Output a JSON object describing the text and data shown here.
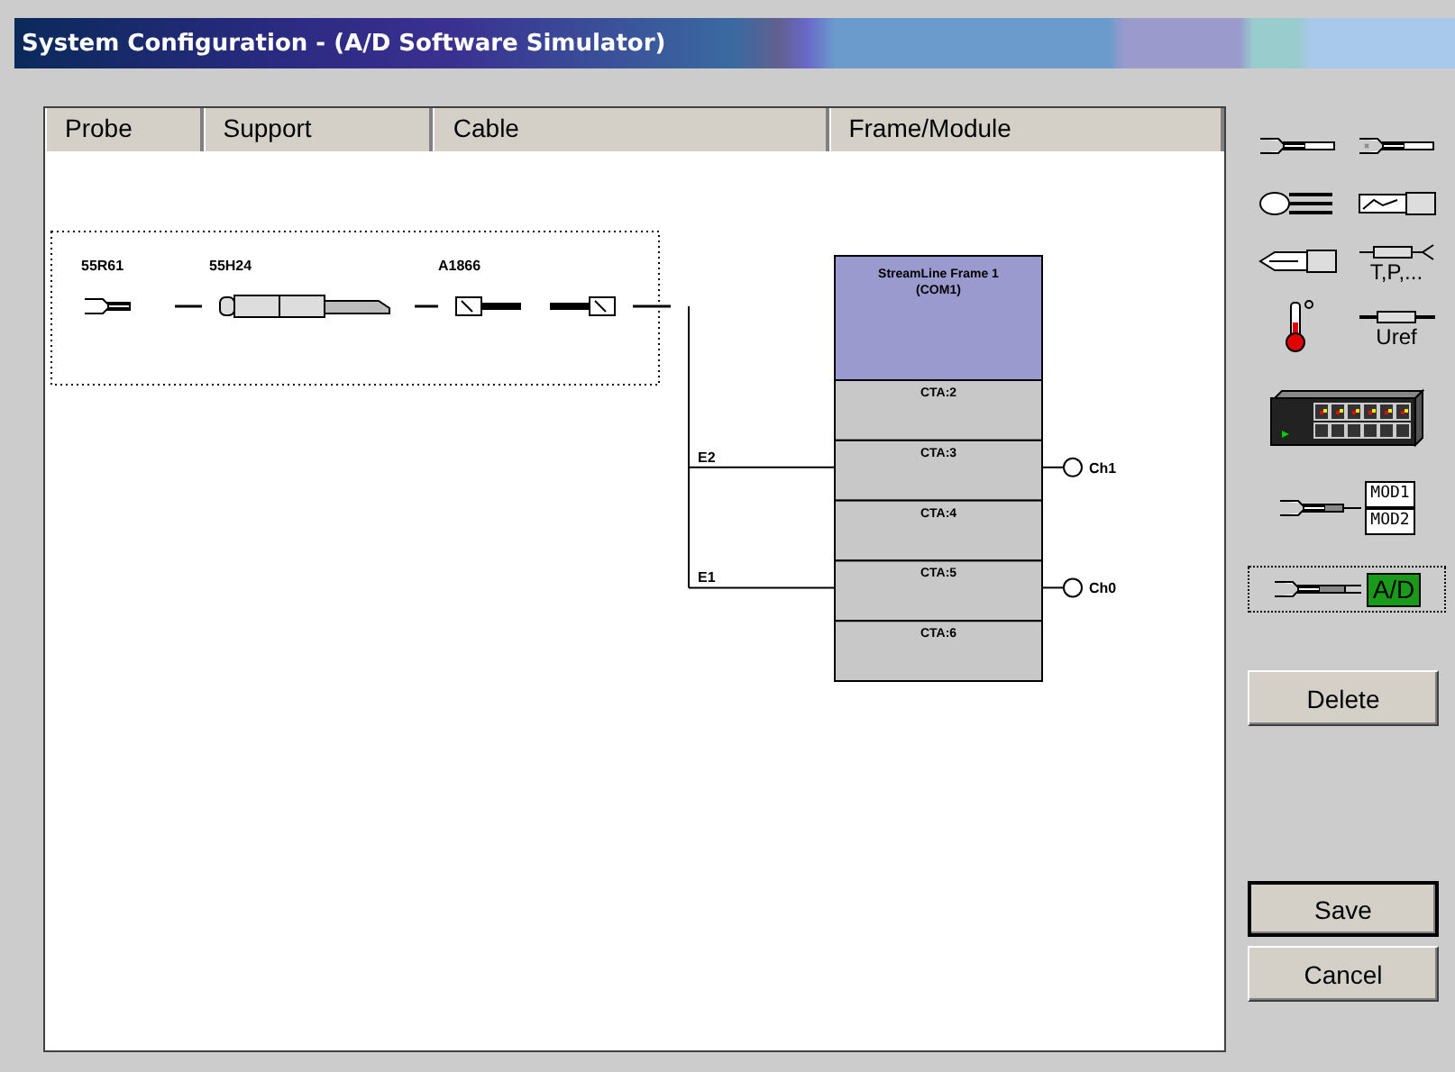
{
  "window": {
    "title": "System Configuration - (A/D Software Simulator)"
  },
  "columns": [
    "Probe",
    "Support",
    "Cable",
    "Frame/Module"
  ],
  "probe_chain": [
    {
      "kind": "probe",
      "label": "55R61"
    },
    {
      "kind": "support",
      "label": "55H24"
    },
    {
      "kind": "cable",
      "label": "A1866"
    }
  ],
  "frame": {
    "title": "StreamLine Frame 1",
    "subtitle": "(COM1)",
    "slots": [
      {
        "label": "CTA:2"
      },
      {
        "label": "CTA:3",
        "input": "E2",
        "output": "Ch1"
      },
      {
        "label": "CTA:4"
      },
      {
        "label": "CTA:5",
        "input": "E1",
        "output": "Ch0"
      },
      {
        "label": "CTA:6"
      }
    ]
  },
  "palette": [
    {
      "kind": "wire-probe",
      "selected": false
    },
    {
      "kind": "wire-probe-x",
      "selected": false
    },
    {
      "kind": "film-probe",
      "selected": false
    },
    {
      "kind": "flat-film-probe",
      "selected": false
    },
    {
      "kind": "wedge-probe",
      "selected": false
    },
    {
      "kind": "multi-probe",
      "label": "T,P,...",
      "selected": false
    },
    {
      "kind": "thermometer",
      "selected": false
    },
    {
      "kind": "reference",
      "label": "Uref",
      "selected": false
    },
    {
      "kind": "frame-unit",
      "selected": false
    },
    {
      "kind": "module",
      "labels": [
        "MOD1",
        "MOD2"
      ],
      "selected": false
    },
    {
      "kind": "ad",
      "label": "A/D",
      "selected": true
    }
  ],
  "buttons": [
    {
      "label": "Delete",
      "default": false
    },
    {
      "label": "Save",
      "default": true
    },
    {
      "label": "Cancel",
      "default": false
    }
  ]
}
